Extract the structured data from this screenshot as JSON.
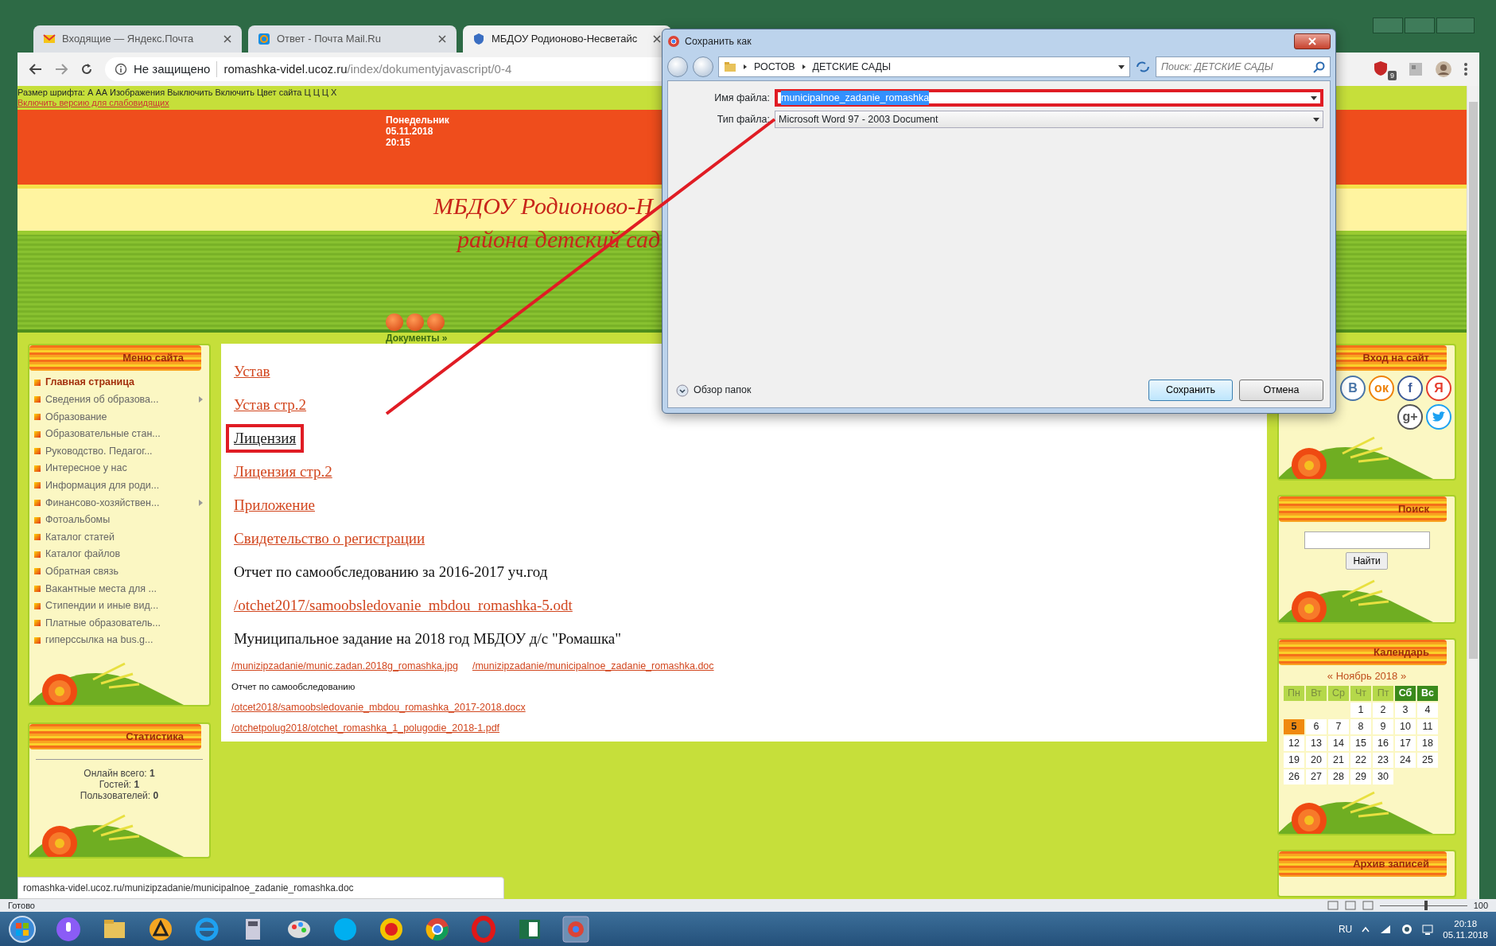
{
  "browser": {
    "tabs": [
      {
        "title": "Входящие — Яндекс.Почта",
        "selected": false
      },
      {
        "title": "Ответ - Почта Mail.Ru",
        "selected": false
      },
      {
        "title": "МБДОУ Родионово-Несветайс",
        "selected": true
      }
    ],
    "security": "Не защищено",
    "url_host": "romashka-videl.ucoz.ru",
    "url_path": "/index/dokumentyjavascript/0-4",
    "extension_badge": "9",
    "status_url": "romashka-videl.ucoz.ru/munizipzadanie/municipalnoe_zadanie_romashka.doc"
  },
  "site": {
    "toolbar": "Размер шрифта: А АА Изображения Выключить Включить Цвет сайта Ц Ц Ц Х",
    "accessibility_link": "Включить версию для слабовидящих",
    "weekday": "Понедельник",
    "date": "05.11.2018",
    "time": "20:15",
    "title_lines": [
      "МБДОУ Родионово-Н",
      "района детский сад"
    ],
    "breadcrumb": "Документы »"
  },
  "left_menu": {
    "title": "Меню сайта",
    "items": [
      {
        "label": "Главная страница",
        "selected": true,
        "has_submenu": false
      },
      {
        "label": "Сведения об образова...",
        "selected": false,
        "has_submenu": true
      },
      {
        "label": "Образование",
        "selected": false,
        "has_submenu": false
      },
      {
        "label": "Образовательные стан...",
        "selected": false,
        "has_submenu": false
      },
      {
        "label": "Руководство. Педагог...",
        "selected": false,
        "has_submenu": false
      },
      {
        "label": "Интересное у нас",
        "selected": false,
        "has_submenu": false
      },
      {
        "label": "Информация для роди...",
        "selected": false,
        "has_submenu": false
      },
      {
        "label": "Финансово-хозяйствен...",
        "selected": false,
        "has_submenu": true
      },
      {
        "label": "Фотоальбомы",
        "selected": false,
        "has_submenu": false
      },
      {
        "label": "Каталог статей",
        "selected": false,
        "has_submenu": false
      },
      {
        "label": "Каталог файлов",
        "selected": false,
        "has_submenu": false
      },
      {
        "label": "Обратная связь",
        "selected": false,
        "has_submenu": false
      },
      {
        "label": "Вакантные места для ...",
        "selected": false,
        "has_submenu": false
      },
      {
        "label": "Стипендии и иные вид...",
        "selected": false,
        "has_submenu": false
      },
      {
        "label": "Платные образователь...",
        "selected": false,
        "has_submenu": false
      },
      {
        "label": "гиперссылка на bus.g...",
        "selected": false,
        "has_submenu": false
      }
    ]
  },
  "stats": {
    "title": "Статистика",
    "lines": [
      {
        "label": "Онлайн всего:",
        "value": "1"
      },
      {
        "label": "Гостей:",
        "value": "1"
      },
      {
        "label": "Пользователей:",
        "value": "0"
      }
    ]
  },
  "content": [
    {
      "kind": "link",
      "text": "Устав",
      "hovered": false,
      "annotated": false
    },
    {
      "kind": "link",
      "text": "Устав стр.2",
      "hovered": false,
      "annotated": false
    },
    {
      "kind": "link",
      "text": "Лицензия",
      "hovered": true,
      "annotated": true
    },
    {
      "kind": "link",
      "text": "Лицензия стр.2",
      "hovered": false,
      "annotated": false
    },
    {
      "kind": "link",
      "text": "Приложение",
      "hovered": false,
      "annotated": false
    },
    {
      "kind": "link",
      "text": "Свидетельство о регистрации",
      "hovered": false,
      "annotated": false
    },
    {
      "kind": "text",
      "text": "Отчет по самообследованию за 2016-2017 уч.год",
      "hovered": false,
      "annotated": false
    },
    {
      "kind": "link",
      "text": "/otchet2017/samoobsledovanie_mbdou_romashka-5.odt",
      "hovered": false,
      "annotated": false
    },
    {
      "kind": "text",
      "text": "Муниципальное задание на 2018 год МБДОУ д/с \"Ромашка\"",
      "hovered": false,
      "annotated": false
    },
    {
      "kind": "small-links",
      "links": [
        "/munizipzadanie/munic.zadan.2018g_romashka.jpg",
        "/munizipzadanie/municipalnoe_zadanie_romashka.doc"
      ],
      "hovered": false,
      "annotated": false
    },
    {
      "kind": "small-text",
      "text": "Отчет по самообследованию",
      "hovered": false,
      "annotated": false
    },
    {
      "kind": "small-link",
      "text": "/otcet2018/samoobsledovanie_mbdou_romashka_2017-2018.docx",
      "hovered": false,
      "annotated": false
    },
    {
      "kind": "small-link",
      "text": "/otchetpolug2018/otchet_romashka_1_polugodie_2018-1.pdf",
      "hovered": false,
      "annotated": false
    }
  ],
  "login": {
    "title": "Вход на сайт",
    "social": [
      {
        "kind": "glyph",
        "glyph": "В",
        "color": "#4a76a8"
      },
      {
        "kind": "glyph",
        "glyph": "ок",
        "color": "#ee8208"
      },
      {
        "kind": "glyph",
        "glyph": "f",
        "color": "#3b5998"
      },
      {
        "kind": "glyph",
        "glyph": "Я",
        "color": "#e53b2c"
      },
      {
        "kind": "glyph",
        "glyph": "g+",
        "color": "#555555"
      },
      {
        "kind": "bird",
        "color": "#1da1f2"
      }
    ]
  },
  "search": {
    "title": "Поиск",
    "button": "Найти"
  },
  "calendar": {
    "title": "Календарь",
    "prev": "«",
    "month": "Ноябрь 2018",
    "next": "»",
    "weekdays": [
      {
        "label": "Пн",
        "weekend": false
      },
      {
        "label": "Вт",
        "weekend": false
      },
      {
        "label": "Ср",
        "weekend": false
      },
      {
        "label": "Чт",
        "weekend": false
      },
      {
        "label": "Пт",
        "weekend": false
      },
      {
        "label": "Сб",
        "weekend": true
      },
      {
        "label": "Вс",
        "weekend": true
      }
    ],
    "weeks": [
      [
        {
          "kind": "blank"
        },
        {
          "kind": "blank"
        },
        {
          "kind": "blank"
        },
        {
          "kind": "day",
          "day": "1",
          "today": false
        },
        {
          "kind": "day",
          "day": "2",
          "today": false
        },
        {
          "kind": "day",
          "day": "3",
          "today": false
        },
        {
          "kind": "day",
          "day": "4",
          "today": false
        }
      ],
      [
        {
          "kind": "day",
          "day": "5",
          "today": true
        },
        {
          "kind": "day",
          "day": "6",
          "today": false
        },
        {
          "kind": "day",
          "day": "7",
          "today": false
        },
        {
          "kind": "day",
          "day": "8",
          "today": false
        },
        {
          "kind": "day",
          "day": "9",
          "today": false
        },
        {
          "kind": "day",
          "day": "10",
          "today": false
        },
        {
          "kind": "day",
          "day": "11",
          "today": false
        }
      ],
      [
        {
          "kind": "day",
          "day": "12",
          "today": false
        },
        {
          "kind": "day",
          "day": "13",
          "today": false
        },
        {
          "kind": "day",
          "day": "14",
          "today": false
        },
        {
          "kind": "day",
          "day": "15",
          "today": false
        },
        {
          "kind": "day",
          "day": "16",
          "today": false
        },
        {
          "kind": "day",
          "day": "17",
          "today": false
        },
        {
          "kind": "day",
          "day": "18",
          "today": false
        }
      ],
      [
        {
          "kind": "day",
          "day": "19",
          "today": false
        },
        {
          "kind": "day",
          "day": "20",
          "today": false
        },
        {
          "kind": "day",
          "day": "21",
          "today": false
        },
        {
          "kind": "day",
          "day": "22",
          "today": false
        },
        {
          "kind": "day",
          "day": "23",
          "today": false
        },
        {
          "kind": "day",
          "day": "24",
          "today": false
        },
        {
          "kind": "day",
          "day": "25",
          "today": false
        }
      ],
      [
        {
          "kind": "day",
          "day": "26",
          "today": false
        },
        {
          "kind": "day",
          "day": "27",
          "today": false
        },
        {
          "kind": "day",
          "day": "28",
          "today": false
        },
        {
          "kind": "day",
          "day": "29",
          "today": false
        },
        {
          "kind": "day",
          "day": "30",
          "today": false
        },
        {
          "kind": "blank"
        },
        {
          "kind": "blank"
        }
      ]
    ]
  },
  "archive": {
    "title": "Архив записей"
  },
  "dialog": {
    "title": "Сохранить как",
    "path": [
      "РОСТОВ",
      "ДЕТСКИЕ САДЫ"
    ],
    "search_placeholder": "Поиск: ДЕТСКИЕ САДЫ",
    "filename_label": "Имя файла:",
    "filename": "municipalnoe_zadanie_romashka",
    "filename_selected": true,
    "filename_annotated": true,
    "filetype_label": "Тип файла:",
    "filetype": "Microsoft Word 97 - 2003 Document",
    "browse_folders": "Обзор папок",
    "buttons": [
      "Сохранить",
      "Отмена"
    ]
  },
  "status_bar": {
    "text": "Готово",
    "zoom": "100",
    "zoom_slider": {
      "level": 0.55
    }
  },
  "taskbar": {
    "lang": "RU",
    "time": "20:18",
    "date": "05.11.2018"
  }
}
